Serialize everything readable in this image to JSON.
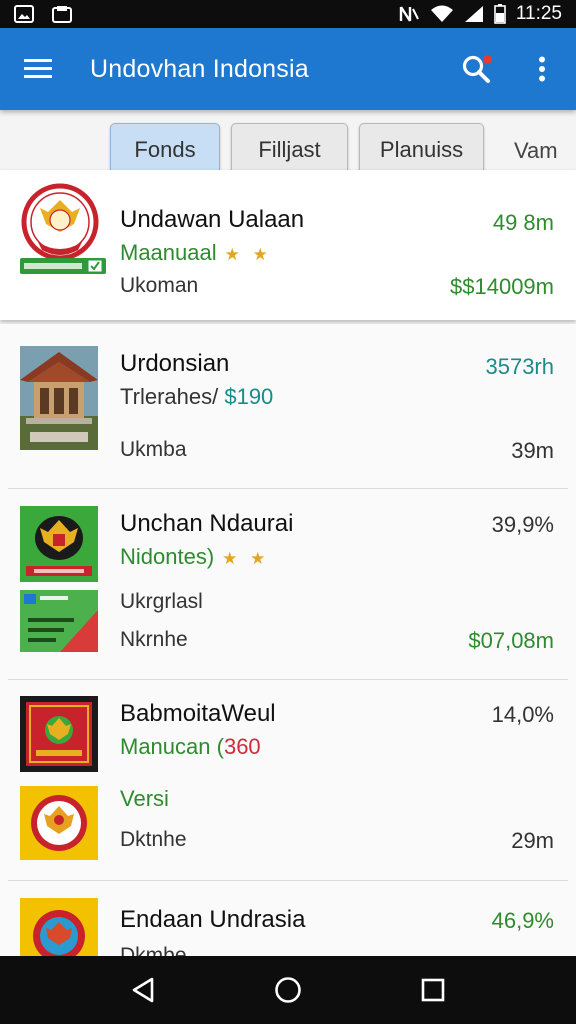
{
  "status_bar": {
    "time": "11:25",
    "icons": [
      "image-icon",
      "notification-icon",
      "nfc-icon",
      "wifi-icon",
      "signal-icon",
      "battery-icon"
    ]
  },
  "app_bar": {
    "title": "Undovhan Indonsia",
    "icons": [
      "menu-icon",
      "search-icon",
      "more-vert-icon"
    ]
  },
  "filters": {
    "chips": [
      "Fonds",
      "Filljast",
      "Planuiss"
    ],
    "more": "Vam",
    "active_index": 0
  },
  "items": [
    {
      "name": "Undawan Ualaan",
      "sub": "Maanuaal",
      "stars": "★ ★",
      "meta": "Ukoman",
      "right_top": "49 8m",
      "right_bottom": "$$14009m",
      "thumb": "emblem-badge"
    },
    {
      "name": "Urdonsian",
      "sub_prefix": "Trlerahes/",
      "sub_value": "$190",
      "meta": "Ukmba",
      "right_top": "3573rh",
      "right_bottom": "39m",
      "thumb": "pavilion-photo"
    },
    {
      "name": "Unchan Ndaurai",
      "sub": "Nidontes)",
      "stars": "★ ★",
      "meta_top": "Ukrgrlasl",
      "meta": "Nkrnhe",
      "right_top": "39,9%",
      "right_bottom": "$07,08m",
      "thumb": "garuda-flag"
    },
    {
      "name": "BabmoitaWeul",
      "sub_prefix": "Manucan (",
      "sub_value": "360",
      "meta_top": "Versi",
      "meta": "Dktnhe",
      "right_top": "14,0%",
      "right_bottom": "29m",
      "thumb": "garuda-red"
    },
    {
      "name": "Endaan Undrasia",
      "meta": "Dkmbe",
      "right_top": "46,9%",
      "thumb": "garuda-yellow"
    }
  ],
  "nav_bar": {
    "icons": [
      "back-icon",
      "home-icon",
      "recents-icon"
    ]
  },
  "colors": {
    "app_bar": "#1e78cf",
    "accent_green": "#2e8b2e",
    "accent_teal": "#1b8a8a",
    "accent_red": "#d12b3a",
    "star": "#e0a820"
  }
}
